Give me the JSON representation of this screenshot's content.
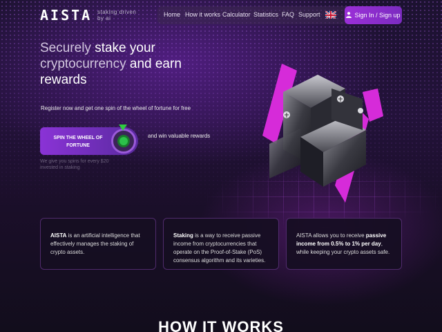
{
  "header": {
    "logo": "AISTA",
    "tagline": "staking driven by ai",
    "nav": [
      "Home",
      "How it works",
      "Calculator",
      "Statistics",
      "FAQ",
      "Support"
    ],
    "language_flag_icon": "uk-flag-icon",
    "signin_label": "Sign In / Sign up",
    "signin_icon": "user-icon"
  },
  "hero": {
    "title_dim_1": "Securely",
    "title_bold_1": "stake your",
    "title_dim_2": "cryptocurrency",
    "title_bold_2": "and earn rewards",
    "promo": "Register now and get one spin of the wheel of fortune for free",
    "spin_button": "SPIN THE WHEEL OF FORTUNE",
    "win_text": "and win valuable rewards",
    "note": "We give you spins for every $20 invested in staking"
  },
  "cards": [
    {
      "bold": "AISTA",
      "text": " is an artificial intelligence that effectively manages the staking of crypto assets."
    },
    {
      "bold": "Staking",
      "text": " is a way to receive passive income from cryptocurrencies that operate on the Proof-of-Stake (PoS) consensus algorithm and its varieties."
    },
    {
      "pre": "AISTA allows you to receive ",
      "bold": "passive income from 0.5% to 1% per day",
      "text": ", while keeping your crypto assets safe."
    }
  ],
  "section_title": "HOW IT WORKS",
  "colors": {
    "accent": "#9b2fd8",
    "background": "#120d1c",
    "neon": "#e040fb",
    "wheel_green": "#2cc24a"
  }
}
